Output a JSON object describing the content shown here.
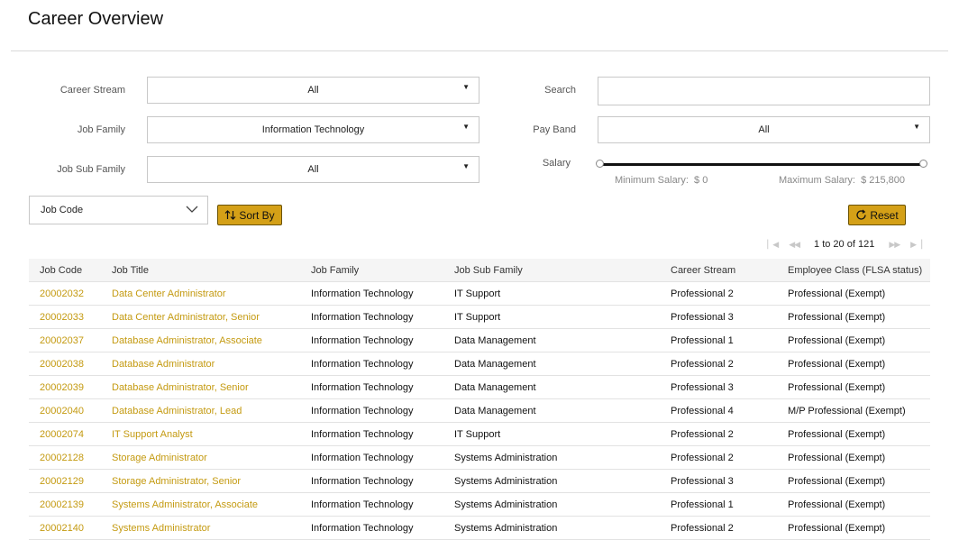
{
  "page": {
    "title": "Career Overview"
  },
  "filters": {
    "career_stream": {
      "label": "Career Stream",
      "value": "All"
    },
    "job_family": {
      "label": "Job Family",
      "value": "Information Technology"
    },
    "job_sub_family": {
      "label": "Job Sub Family",
      "value": "All"
    },
    "search": {
      "label": "Search",
      "value": "",
      "placeholder": ""
    },
    "pay_band": {
      "label": "Pay Band",
      "value": "All"
    },
    "salary": {
      "label": "Salary",
      "min_label": "Minimum Salary:",
      "min_value": "$ 0",
      "max_label": "Maximum Salary:",
      "max_value": "$ 215,800",
      "range_low_fraction": 0,
      "range_high_fraction": 1
    }
  },
  "sort": {
    "field": "Job Code",
    "button_label": "Sort By"
  },
  "reset": {
    "label": "Reset"
  },
  "pagination": {
    "info": "1 to 20 of 121"
  },
  "colors": {
    "accent": "#d4a017",
    "link": "#c49a10",
    "header_bg": "#f5f5f5"
  },
  "table": {
    "columns": [
      "Job Code",
      "Job Title",
      "Job Family",
      "Job Sub Family",
      "Career Stream",
      "Employee Class (FLSA status)"
    ],
    "rows": [
      [
        "20002032",
        "Data Center Administrator",
        "Information Technology",
        "IT Support",
        "Professional 2",
        "Professional (Exempt)"
      ],
      [
        "20002033",
        "Data Center Administrator, Senior",
        "Information Technology",
        "IT Support",
        "Professional 3",
        "Professional (Exempt)"
      ],
      [
        "20002037",
        "Database Administrator, Associate",
        "Information Technology",
        "Data Management",
        "Professional 1",
        "Professional (Exempt)"
      ],
      [
        "20002038",
        "Database Administrator",
        "Information Technology",
        "Data Management",
        "Professional 2",
        "Professional (Exempt)"
      ],
      [
        "20002039",
        "Database Administrator, Senior",
        "Information Technology",
        "Data Management",
        "Professional 3",
        "Professional (Exempt)"
      ],
      [
        "20002040",
        "Database Administrator, Lead",
        "Information Technology",
        "Data Management",
        "Professional 4",
        "M/P Professional (Exempt)"
      ],
      [
        "20002074",
        "IT Support Analyst",
        "Information Technology",
        "IT Support",
        "Professional 2",
        "Professional (Exempt)"
      ],
      [
        "20002128",
        "Storage Administrator",
        "Information Technology",
        "Systems Administration",
        "Professional 2",
        "Professional (Exempt)"
      ],
      [
        "20002129",
        "Storage Administrator, Senior",
        "Information Technology",
        "Systems Administration",
        "Professional 3",
        "Professional (Exempt)"
      ],
      [
        "20002139",
        "Systems Administrator, Associate",
        "Information Technology",
        "Systems Administration",
        "Professional 1",
        "Professional (Exempt)"
      ],
      [
        "20002140",
        "Systems Administrator",
        "Information Technology",
        "Systems Administration",
        "Professional 2",
        "Professional (Exempt)"
      ]
    ]
  }
}
